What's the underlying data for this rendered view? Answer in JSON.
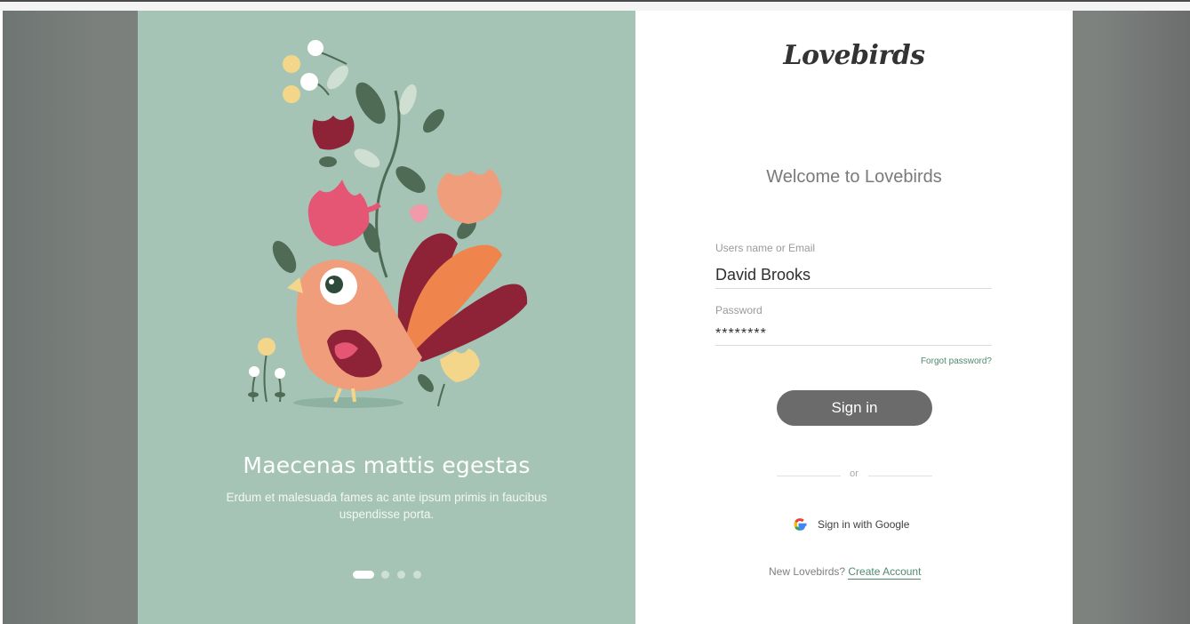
{
  "brand": {
    "logo_text": "Lovebirds"
  },
  "promo": {
    "title": "Maecenas mattis egestas",
    "subtitle": "Erdum et malesuada fames ac ante ipsum primis in faucibus uspendisse porta.",
    "pager_total": 4,
    "pager_active": 1
  },
  "login": {
    "welcome": "Welcome to Lovebirds",
    "username_label": "Users name or Email",
    "username_value": "David Brooks",
    "password_label": "Password",
    "password_value": "********",
    "forgot_label": "Forgot password?",
    "signin_label": "Sign in",
    "or_text": "or",
    "google_label": "Sign in with Google",
    "new_prompt": "New Lovebirds?",
    "create_label": "Create Account"
  },
  "colors": {
    "panel_green": "#a5c4b6",
    "button_gray": "#6b6b6b",
    "link_green": "#4f8a6d"
  },
  "icons": [
    "google-icon"
  ]
}
